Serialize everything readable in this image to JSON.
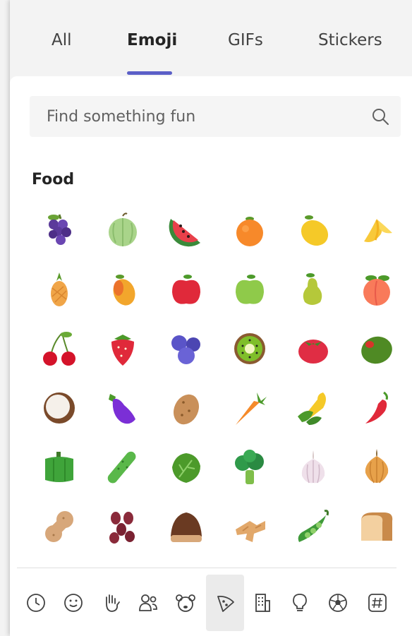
{
  "tabs": [
    {
      "label": "All"
    },
    {
      "label": "Emoji"
    },
    {
      "label": "GIFs"
    },
    {
      "label": "Stickers"
    }
  ],
  "search": {
    "placeholder": "Find something fun"
  },
  "section": {
    "title": "Food"
  },
  "emojis": [
    "grapes",
    "melon",
    "watermelon",
    "tangerine",
    "lemon",
    "banana",
    "pineapple",
    "mango",
    "red-apple",
    "green-apple",
    "pear",
    "peach",
    "cherries",
    "strawberry",
    "blueberries",
    "kiwi",
    "tomato",
    "olive",
    "coconut",
    "eggplant",
    "potato",
    "carrot",
    "corn",
    "hot-pepper",
    "bell-pepper",
    "cucumber",
    "leafy-green",
    "broccoli",
    "garlic",
    "onion",
    "peanuts",
    "beans",
    "chestnut",
    "ginger",
    "pea-pod",
    "bread"
  ],
  "categories": [
    "recent-icon",
    "smiley-icon",
    "hand-icon",
    "people-icon",
    "animal-icon",
    "food-icon",
    "building-icon",
    "lightbulb-icon",
    "soccer-ball-icon",
    "symbols-icon"
  ],
  "active_category": "food-icon",
  "colors": {
    "accent": "#5b5fc7",
    "panel": "#ffffff",
    "background": "#f3f3f3"
  }
}
